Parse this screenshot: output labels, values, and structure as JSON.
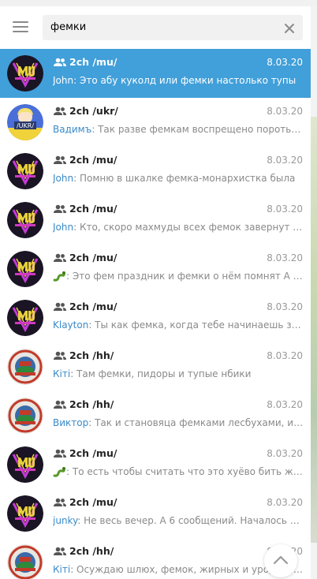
{
  "search": {
    "query": "фемки"
  },
  "colors": {
    "accent": "#419fd9",
    "sender": "#3a8ac8"
  },
  "icons": {
    "menu": "hamburger-icon",
    "clear": "close-icon",
    "group": "group-icon",
    "scroll": "chevron-up-icon"
  },
  "results": [
    {
      "chat": "2ch /mu/",
      "date": "8.03.20",
      "sender": "John",
      "text": "Это абу куколд или фемки настолько тупы",
      "avatar": "mu",
      "active": true
    },
    {
      "chat": "2ch /ukr/",
      "date": "8.03.20",
      "sender": "Вадимъ",
      "text": "Так разве фемкам воспрещено пороться в ж...",
      "avatar": "ukr",
      "active": false
    },
    {
      "chat": "2ch /mu/",
      "date": "8.03.20",
      "sender": "John",
      "text": "Помню в шкалке фемка-монархистка была",
      "avatar": "mu",
      "active": false
    },
    {
      "chat": "2ch /mu/",
      "date": "8.03.20",
      "sender": "John",
      "text": "Кто, скоро махмуды всех фемок завернут в ...",
      "avatar": "mu",
      "active": false
    },
    {
      "chat": "2ch /mu/",
      "date": "8.03.20",
      "sender": "",
      "text": "Это фем праздник и фемки о нём помнят А п...",
      "avatar": "mu",
      "active": false,
      "snake": true
    },
    {
      "chat": "2ch /mu/",
      "date": "8.03.20",
      "sender": "Klayton",
      "text": "Ты как фемка, когда тебе начинаешь зад...",
      "avatar": "mu",
      "active": false
    },
    {
      "chat": "2ch /hh/",
      "date": "8.03.20",
      "sender": "Кiтi",
      "text": "Там фемки, пидоры и тупые нбики",
      "avatar": "hh",
      "active": false
    },
    {
      "chat": "2ch /hh/",
      "date": "8.03.20",
      "sender": "Виктор",
      "text": "Так и становяца фемками лесбухами, ил...",
      "avatar": "hh",
      "active": false
    },
    {
      "chat": "2ch /mu/",
      "date": "8.03.20",
      "sender": "",
      "text": "То есть чтобы считать что это хуёво бить же...",
      "avatar": "mu",
      "active": false,
      "snake": true
    },
    {
      "chat": "2ch /mu/",
      "date": "8.03.20",
      "sender": "junky",
      "text": "Не весь вечер. А 6 сообщений. Началось с ...",
      "avatar": "mu",
      "active": false
    },
    {
      "chat": "2ch /hh/",
      "date": "8.03.20",
      "sender": "Кiтi",
      "text": "Осуждаю шлюх, фемок, жирных и уродливых",
      "avatar": "hh",
      "active": false
    }
  ],
  "avatar_texts": {
    "ukr": "/UKR/"
  }
}
